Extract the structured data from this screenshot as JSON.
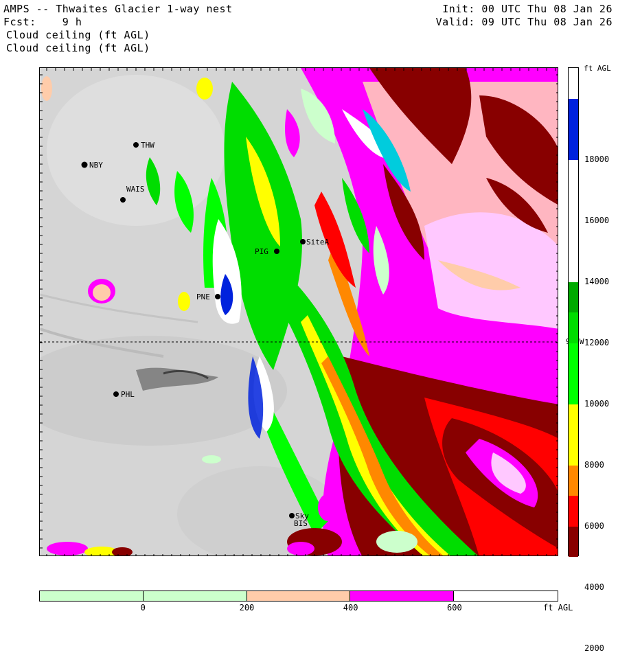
{
  "header": {
    "title": "AMPS -- Thwaites Glacier 1-way nest",
    "fcst_label": "Fcst:",
    "fcst_value": "9 h",
    "init": "Init: 00 UTC Thu 08 Jan 26",
    "valid": "Valid: 09 UTC Thu 08 Jan 26",
    "field_1": "Cloud ceiling (ft AGL)",
    "field_2": "Cloud ceiling (ft AGL)"
  },
  "map": {
    "stations": [
      {
        "name": "THW"
      },
      {
        "name": "NBY"
      },
      {
        "name": "WAIS"
      },
      {
        "name": "PIG"
      },
      {
        "name": "SiteA"
      },
      {
        "name": "PNE"
      },
      {
        "name": "PHL"
      },
      {
        "name": "Sky"
      },
      {
        "name": "BIS"
      }
    ],
    "meridian_label": "90 W"
  },
  "vertical_colorbar": {
    "unit": "ft AGL",
    "ticks": [
      "18000",
      "16000",
      "14000",
      "12000",
      "10000",
      "8000",
      "6000",
      "4000",
      "2000"
    ],
    "colors": [
      "#ffffff",
      "#0022dd",
      "#0022dd",
      "#ffffff",
      "#ffffff",
      "#ffffff",
      "#ffffff",
      "#00aa00",
      "#00dd00",
      "#00ff00",
      "#00ff00",
      "#ffff00",
      "#ffff00",
      "#ff8800",
      "#ff0000",
      "#880000"
    ]
  },
  "horizontal_colorbar": {
    "unit": "ft AGL",
    "ticks": [
      "0",
      "200",
      "400",
      "600"
    ],
    "colors": [
      "#ccffcc",
      "#ccffcc",
      "#ffccaa",
      "#ff00ff",
      "#ffffff"
    ]
  }
}
